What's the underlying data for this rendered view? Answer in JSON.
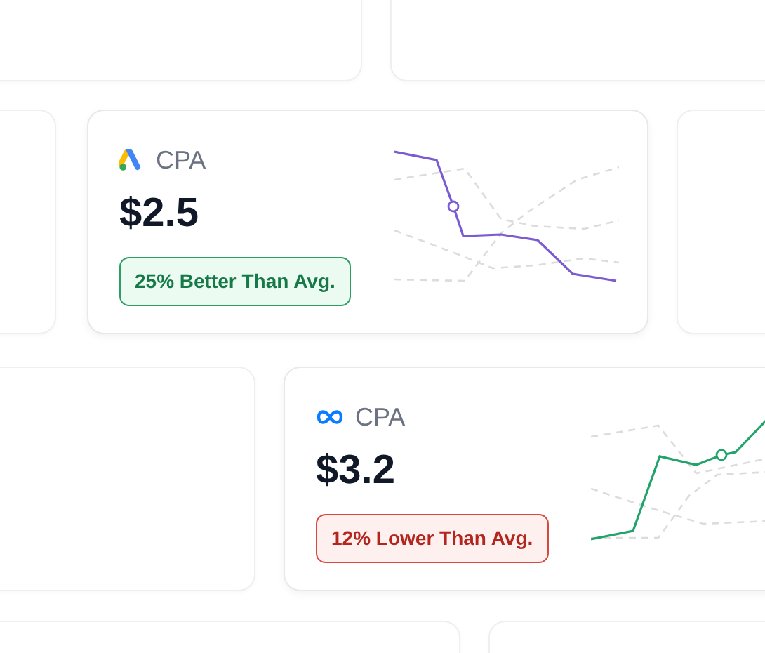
{
  "cards": [
    {
      "kind": "triangle",
      "label": "CPA",
      "value": "$2.5",
      "badge": {
        "text": "25% Better Than Avg.",
        "kind": "positive"
      },
      "color": "#7b5bd0"
    },
    {
      "kind": "loop",
      "label": "CPA",
      "value": "$3.2",
      "badge": {
        "text": "12% Lower Than Avg.",
        "kind": "negative"
      },
      "color": "#22a36b"
    }
  ]
}
